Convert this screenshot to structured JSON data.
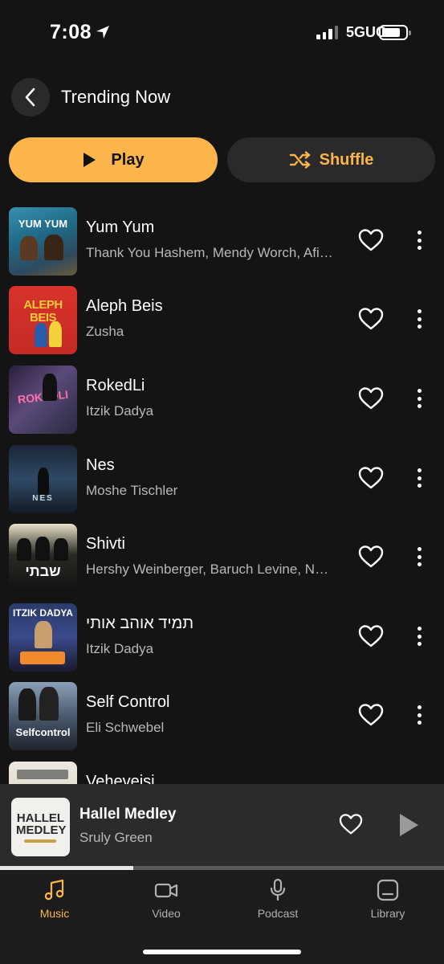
{
  "status_bar": {
    "time": "7:08",
    "network": "5GUC"
  },
  "header": {
    "title": "Trending Now"
  },
  "actions": {
    "play_label": "Play",
    "shuffle_label": "Shuffle"
  },
  "tracks": [
    {
      "title": "Yum Yum",
      "artists": "Thank You Hashem, Mendy Worch, Afi…",
      "art_text": "YUM YUM"
    },
    {
      "title": "Aleph Beis",
      "artists": "Zusha",
      "art_text": "ALEPH BEIS"
    },
    {
      "title": "RokedLi",
      "artists": "Itzik Dadya",
      "art_text": "ROKEDLI"
    },
    {
      "title": "Nes",
      "artists": "Moshe Tischler",
      "art_text": "NES"
    },
    {
      "title": "Shivti",
      "artists": "Hershy Weinberger, Baruch Levine, Na…",
      "art_text": "שבתי"
    },
    {
      "title": "תמיד אוהב אותי",
      "artists": "Itzik Dadya",
      "art_text": "ITZIK DADYA"
    },
    {
      "title": "Self Control",
      "artists": "Eli Schwebel",
      "art_text": "Selfcontrol"
    },
    {
      "title": "Veheveisi",
      "artists": "",
      "art_text": ""
    }
  ],
  "now_playing": {
    "title": "Hallel Medley",
    "artist": "Sruly Green",
    "art_text": "HALLEL MEDLEY",
    "progress": 0.3
  },
  "tabs": [
    {
      "label": "Music",
      "active": true
    },
    {
      "label": "Video",
      "active": false
    },
    {
      "label": "Podcast",
      "active": false
    },
    {
      "label": "Library",
      "active": false
    }
  ],
  "colors": {
    "accent": "#fbb54a",
    "background": "#141414",
    "surface": "#2a2a2a"
  }
}
